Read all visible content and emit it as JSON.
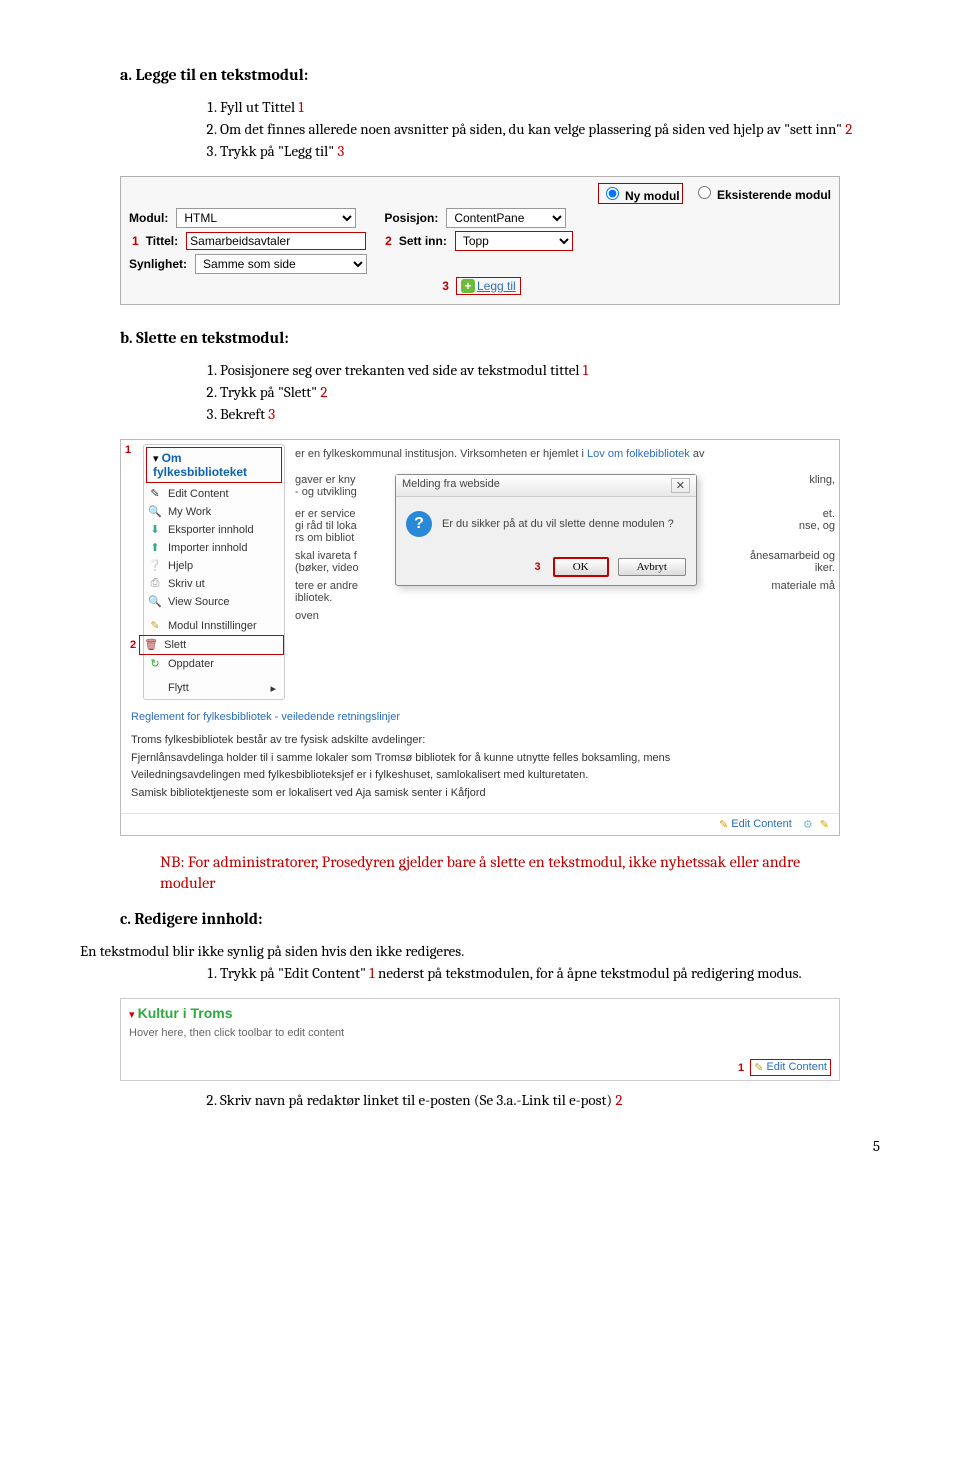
{
  "section_a": {
    "title": "a.   Legge til en tekstmodul:",
    "items": [
      "Fyll ut Tittel ",
      "Om det finnes allerede noen avsnitter på siden, du kan velge plassering på siden ved hjelp av \"sett inn\" ",
      "Trykk på \"Legg til\" "
    ],
    "marks": [
      "1",
      "2",
      "3"
    ]
  },
  "panel": {
    "radio_ny": "Ny modul",
    "radio_eks": "Eksisterende modul",
    "modul_label": "Modul:",
    "modul_value": "HTML",
    "posisjon_label": "Posisjon:",
    "posisjon_value": "ContentPane",
    "tittel_label": "Tittel:",
    "tittel_value": "Samarbeidsavtaler",
    "settinn_label": "Sett inn:",
    "settinn_value": "Topp",
    "synlighet_label": "Synlighet:",
    "synlighet_value": "Samme som side",
    "legg_label": "Legg til",
    "m1": "1",
    "m2": "2",
    "m3": "3"
  },
  "section_b": {
    "title": "b.   Slette en tekstmodul:",
    "items": [
      "Posisjonere seg over trekanten ved side av tekstmodul tittel ",
      "Trykk på \"Slett\" ",
      "Bekreft "
    ],
    "marks": [
      "1",
      "2",
      "3"
    ]
  },
  "shot2": {
    "m1": "1",
    "m2": "2",
    "m3": "3",
    "heading": "Om fylkesbiblioteket",
    "intro_a": "er en fylkeskommunal institusjon. Virksomheten er hjemlet i ",
    "intro_link": "Lov om folkebibliotek",
    "intro_b": " av",
    "ctx": [
      "Edit Content",
      "My Work",
      "Eksporter innhold",
      "Importer innhold",
      "Hjelp",
      "Skriv ut",
      "View Source",
      "Modul Innstillinger",
      "Slett",
      "Oppdater",
      "Flytt"
    ],
    "dialog_title": "Melding fra webside",
    "dialog_text": "Er du sikker på at du vil slette denne modulen ?",
    "ok": "OK",
    "avbryt": "Avbryt",
    "body_frag1": "gaver er kny",
    "body_frag2": "- og utvikling",
    "body_frag3a": "er er service",
    "body_frag3b": "gi råd til loka",
    "body_frag3c": "rs om bibliot",
    "body_frag4a": "skal ivareta f",
    "body_frag4b": "(bøker, video",
    "body_frag5a": "tere er andre",
    "body_frag5b": "ibliotek.",
    "body_frag6": "oven",
    "body_trail1": "kling,",
    "body_trail2a": "et.",
    "body_trail2b": "nse, og",
    "body_trail3a": "ånesamarbeid og",
    "body_trail3b": "iker.",
    "body_trail4": "materiale må",
    "reg_line": "Reglement for fylkesbibliotek - veiledende retningslinjer",
    "beskriv": "Troms fylkesbibliotek består av tre fysisk adskilte avdelinger:",
    "b1": "Fjernlånsavdelinga holder til i samme lokaler som Tromsø bibliotek for å kunne utnytte felles boksamling, mens",
    "b2": "Veiledningsavdelingen med fylkesbiblioteksjef er i fylkeshuset, samlokalisert med kulturetaten.",
    "b3": "Samisk bibliotektjeneste som er lokalisert ved Aja samisk senter i Kåfjord",
    "edit_content": "Edit Content"
  },
  "note": "NB: For administratorer, Prosedyren gjelder bare å slette en tekstmodul, ikke nyhetssak eller andre moduler",
  "section_c": {
    "title": "c.   Redigere innhold:",
    "intro": "En tekstmodul blir ikke synlig på siden hvis den ikke redigeres.",
    "item1": "Trykk på \"Edit Content\" ",
    "m1": "1",
    "item1_cont": " nederst på tekstmodulen, for å åpne tekstmodul på redigering modus."
  },
  "shot3": {
    "title": "Kultur i Troms",
    "hover": "Hover here, then click toolbar to edit content",
    "m1": "1",
    "edit": "Edit Content"
  },
  "section_c_item2": {
    "text": "Skriv navn på redaktør linket til e-posten (Se 3.a.-Link til e-post) ",
    "m": "2"
  },
  "page_no": "5"
}
